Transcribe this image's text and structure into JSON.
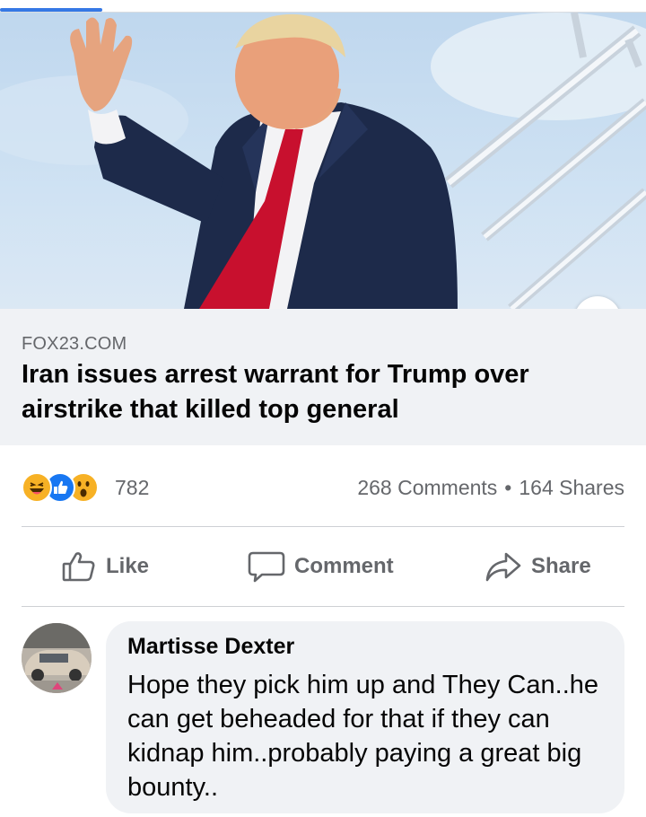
{
  "link_preview": {
    "domain": "FOX23.COM",
    "title": "Iran issues arrest warrant for Trump over airstrike that killed top general",
    "info_icon": "info-icon"
  },
  "stats": {
    "reactions": [
      "haha",
      "like",
      "wow"
    ],
    "reaction_count": "782",
    "comments": "268 Comments",
    "separator": "•",
    "shares": "164 Shares"
  },
  "actions": {
    "like": "Like",
    "comment": "Comment",
    "share": "Share"
  },
  "comment": {
    "author": "Martisse Dexter",
    "text": "Hope they pick him up and They Can..he can get beheaded for that if they can kidnap him..probably paying a great big bounty.."
  },
  "colors": {
    "accent": "#3578e5",
    "muted_text": "#65676b",
    "panel_bg": "#f0f2f5"
  }
}
